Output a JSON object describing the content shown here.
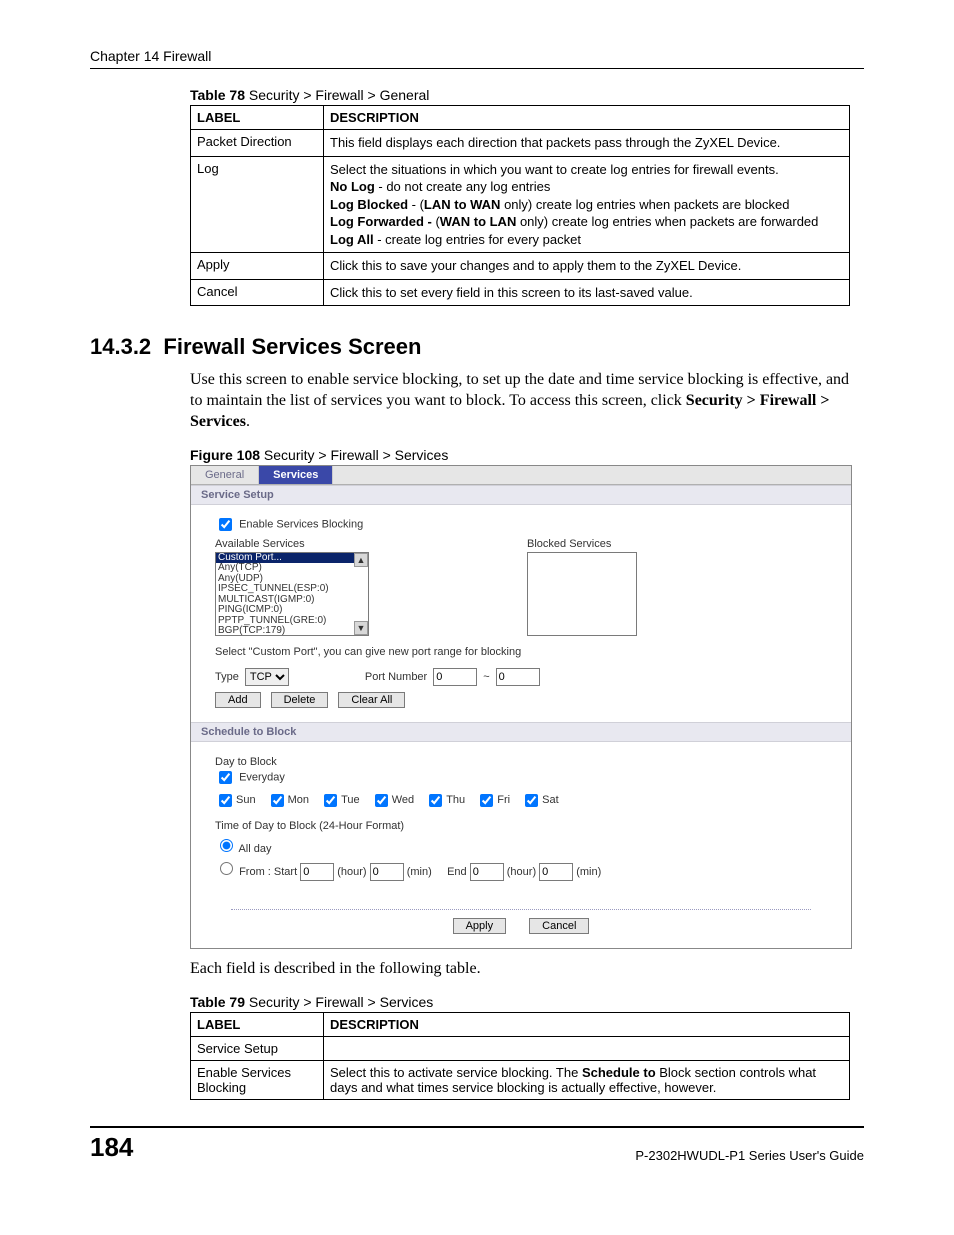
{
  "runningHead": "Chapter 14 Firewall",
  "table78": {
    "captionPrefix": "Table 78",
    "captionText": "   Security > Firewall > General",
    "headers": {
      "label": "LABEL",
      "desc": "DESCRIPTION"
    },
    "rows": [
      {
        "label": "Packet Direction",
        "descLines": [
          {
            "text": "This field displays each direction that packets pass through the ZyXEL Device."
          }
        ]
      },
      {
        "label": "Log",
        "descLines": [
          {
            "text": "Select the situations in which you want to create log entries for firewall events."
          },
          {
            "boldLead": "No Log",
            "rest": " - do not create any log entries"
          },
          {
            "boldLead": "Log Blocked",
            "rest": " - (",
            "bold2": "LAN to WAN",
            "rest2": " only) create log entries when packets are blocked"
          },
          {
            "boldLead": "Log Forwarded -",
            "rest": " (",
            "bold2": "WAN to LAN",
            "rest2": " only) create log entries when packets are forwarded"
          },
          {
            "boldLead": "Log All",
            "rest": " - create log entries for every packet"
          }
        ]
      },
      {
        "label": "Apply",
        "descLines": [
          {
            "text": "Click this to save your changes and to apply them to the ZyXEL Device."
          }
        ]
      },
      {
        "label": "Cancel",
        "descLines": [
          {
            "text": "Click this to set every field in this screen to its last-saved value."
          }
        ]
      }
    ]
  },
  "section": {
    "number": "14.3.2",
    "title": "Firewall Services Screen",
    "para": "Use this screen to enable service blocking, to set up the date and time service blocking is effective, and to maintain the list of services you want to block. To access this screen, click ",
    "navPath": "Security > Firewall > Services",
    "navTail": "."
  },
  "figure": {
    "captionPrefix": "Figure 108",
    "captionText": "   Security > Firewall > Services",
    "tabs": {
      "general": "General",
      "services": "Services"
    },
    "serviceSetupHeader": "Service Setup",
    "enableLabel": "Enable Services Blocking",
    "availableLabel": "Available Services",
    "blockedLabel": "Blocked Services",
    "availableItems": [
      "Custom Port...",
      "Any(TCP)",
      "Any(UDP)",
      "IPSEC_TUNNEL(ESP:0)",
      "MULTICAST(IGMP:0)",
      "PING(ICMP:0)",
      "PPTP_TUNNEL(GRE:0)",
      "BGP(TCP:179)"
    ],
    "hint": "Select \"Custom Port\", you can give new port range for blocking",
    "typeLabel": "Type",
    "typeValue": "TCP",
    "portLabel": "Port Number",
    "portFrom": "0",
    "portTilde": "~",
    "portTo": "0",
    "addBtn": "Add",
    "deleteBtn": "Delete",
    "clearBtn": "Clear All",
    "scheduleHeader": "Schedule to Block",
    "dayToBlock": "Day to Block",
    "everyday": "Everyday",
    "days": {
      "sun": "Sun",
      "mon": "Mon",
      "tue": "Tue",
      "wed": "Wed",
      "thu": "Thu",
      "fri": "Fri",
      "sat": "Sat"
    },
    "timeHeader": "Time of Day to Block (24-Hour Format)",
    "allDay": "All day",
    "fromLabel": "From :   Start",
    "hourLabel": "(hour)",
    "minLabel": "(min)",
    "endLabel": "End",
    "timeVals": {
      "sh": "0",
      "sm": "0",
      "eh": "0",
      "em": "0"
    },
    "applyBtn": "Apply",
    "cancelBtn": "Cancel"
  },
  "afterFigure": "Each field is described in the following table.",
  "table79": {
    "captionPrefix": "Table 79",
    "captionText": "   Security > Firewall > Services",
    "headers": {
      "label": "LABEL",
      "desc": "DESCRIPTION"
    },
    "rows": [
      {
        "label": "Service Setup",
        "descText": ""
      },
      {
        "label": "Enable Services Blocking",
        "descPre": "Select this to activate service blocking. The ",
        "descBold": "Schedule to",
        "descPost": " Block section controls what days and what times service blocking is actually effective, however."
      }
    ]
  },
  "footer": {
    "page": "184",
    "guide": "P-2302HWUDL-P1 Series User's Guide"
  }
}
